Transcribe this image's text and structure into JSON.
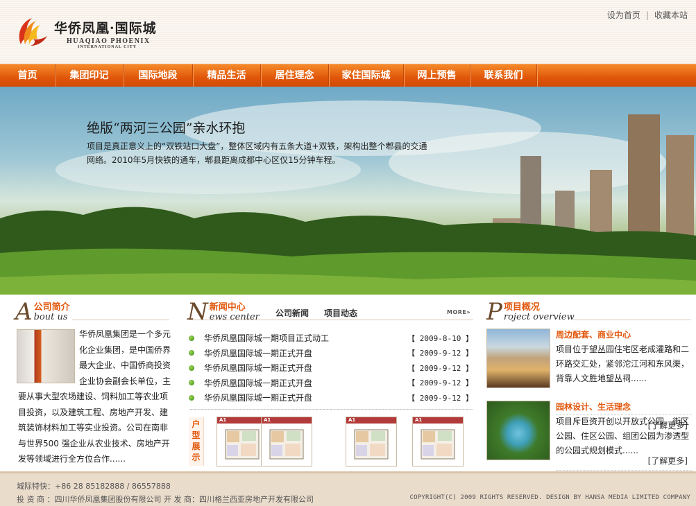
{
  "header": {
    "logo_cn": "华侨凤凰·国际城",
    "logo_en": "HUAQIAO PHOENIX",
    "logo_en_sub": "INTERNATIONAL CITY",
    "set_home": "设为首页",
    "separator": "|",
    "bookmark": "收藏本站"
  },
  "nav": {
    "items": [
      {
        "label": "首页"
      },
      {
        "label": "集团印记"
      },
      {
        "label": "国际地段"
      },
      {
        "label": "精品生活"
      },
      {
        "label": "居住理念"
      },
      {
        "label": "家住国际城"
      },
      {
        "label": "网上预售"
      },
      {
        "label": "联系我们"
      }
    ]
  },
  "banner": {
    "title": "绝版“两河三公园”亲水环抱",
    "desc": "项目是真正意义上的“双铁站口大盘”，整体区域内有五条大道+双铁，架构出整个郫县的交通网络。2010年5月快铁的通车，郫县距离成都中心区仅15分钟车程。"
  },
  "about": {
    "letter": "A",
    "cn": "公司简介",
    "en": "bout us",
    "text": "华侨凤凰集团是一个多元化企业集团，是中国侨界最大企业、中国侨商投资企业协会副会长单位，主要从事大型农场建设、饲料加工等农业项目投资，以及建筑工程、房地产开发、建筑装饰材料加工等实业投资。公司在南非与世界500 强企业从农业技术、房地产开发等领域进行全方位合作......"
  },
  "news": {
    "letter": "N",
    "cn": "新闻中心",
    "en": "ews center",
    "tab_company": "公司新闻",
    "tab_project": "项目动态",
    "more": "MORE»",
    "items": [
      {
        "title": "华侨凤凰国际城一期项目正式动工",
        "date": "【 2009-8-10 】"
      },
      {
        "title": "华侨凤凰国际城一期正式开盘",
        "date": "【 2009-9-12 】"
      },
      {
        "title": "华侨凤凰国际城一期正式开盘",
        "date": "【 2009-9-12 】"
      },
      {
        "title": "华侨凤凰国际城一期正式开盘",
        "date": "【 2009-9-12 】"
      },
      {
        "title": "华侨凤凰国际城一期正式开盘",
        "date": "【 2009-9-12 】"
      }
    ],
    "huxing_label": "户型展示",
    "plans": [
      {
        "label": "A1"
      },
      {
        "label": "A1"
      },
      {
        "label": "A1"
      },
      {
        "label": "A1"
      }
    ]
  },
  "project": {
    "letter": "P",
    "cn": "项目概况",
    "en": "roject overview",
    "items": [
      {
        "title": "周边配套、商业中心",
        "desc": "项目位于望丛园住宅区老成灌路和二环路交汇处，紧邻沱江河和东风渠，背靠人文胜地望丛祠......",
        "more": "[了解更多]"
      },
      {
        "title": "园林设计、生活理念",
        "desc": "项目斥巨资开创以开放式公园、街区公园、住区公园、组团公园为渗透型的公园式规划模式......",
        "more": "[了解更多]"
      }
    ]
  },
  "footer": {
    "hotline": "城际特快：+86 28 85182888 / 86557888",
    "investor": "投 资 商 ：四川华侨凤凰集团股份有限公司   开 发 商：四川格兰西亚房地产开发有限公司",
    "copyright": "COPYRIGHT(C) 2009  RIGHTS RESERVED. DESIGN BY HANSA MEDIA LIMITED COMPANY"
  },
  "colors": {
    "accent": "#e2580c",
    "nav": "#e0560a",
    "footer": "#eadccb"
  }
}
